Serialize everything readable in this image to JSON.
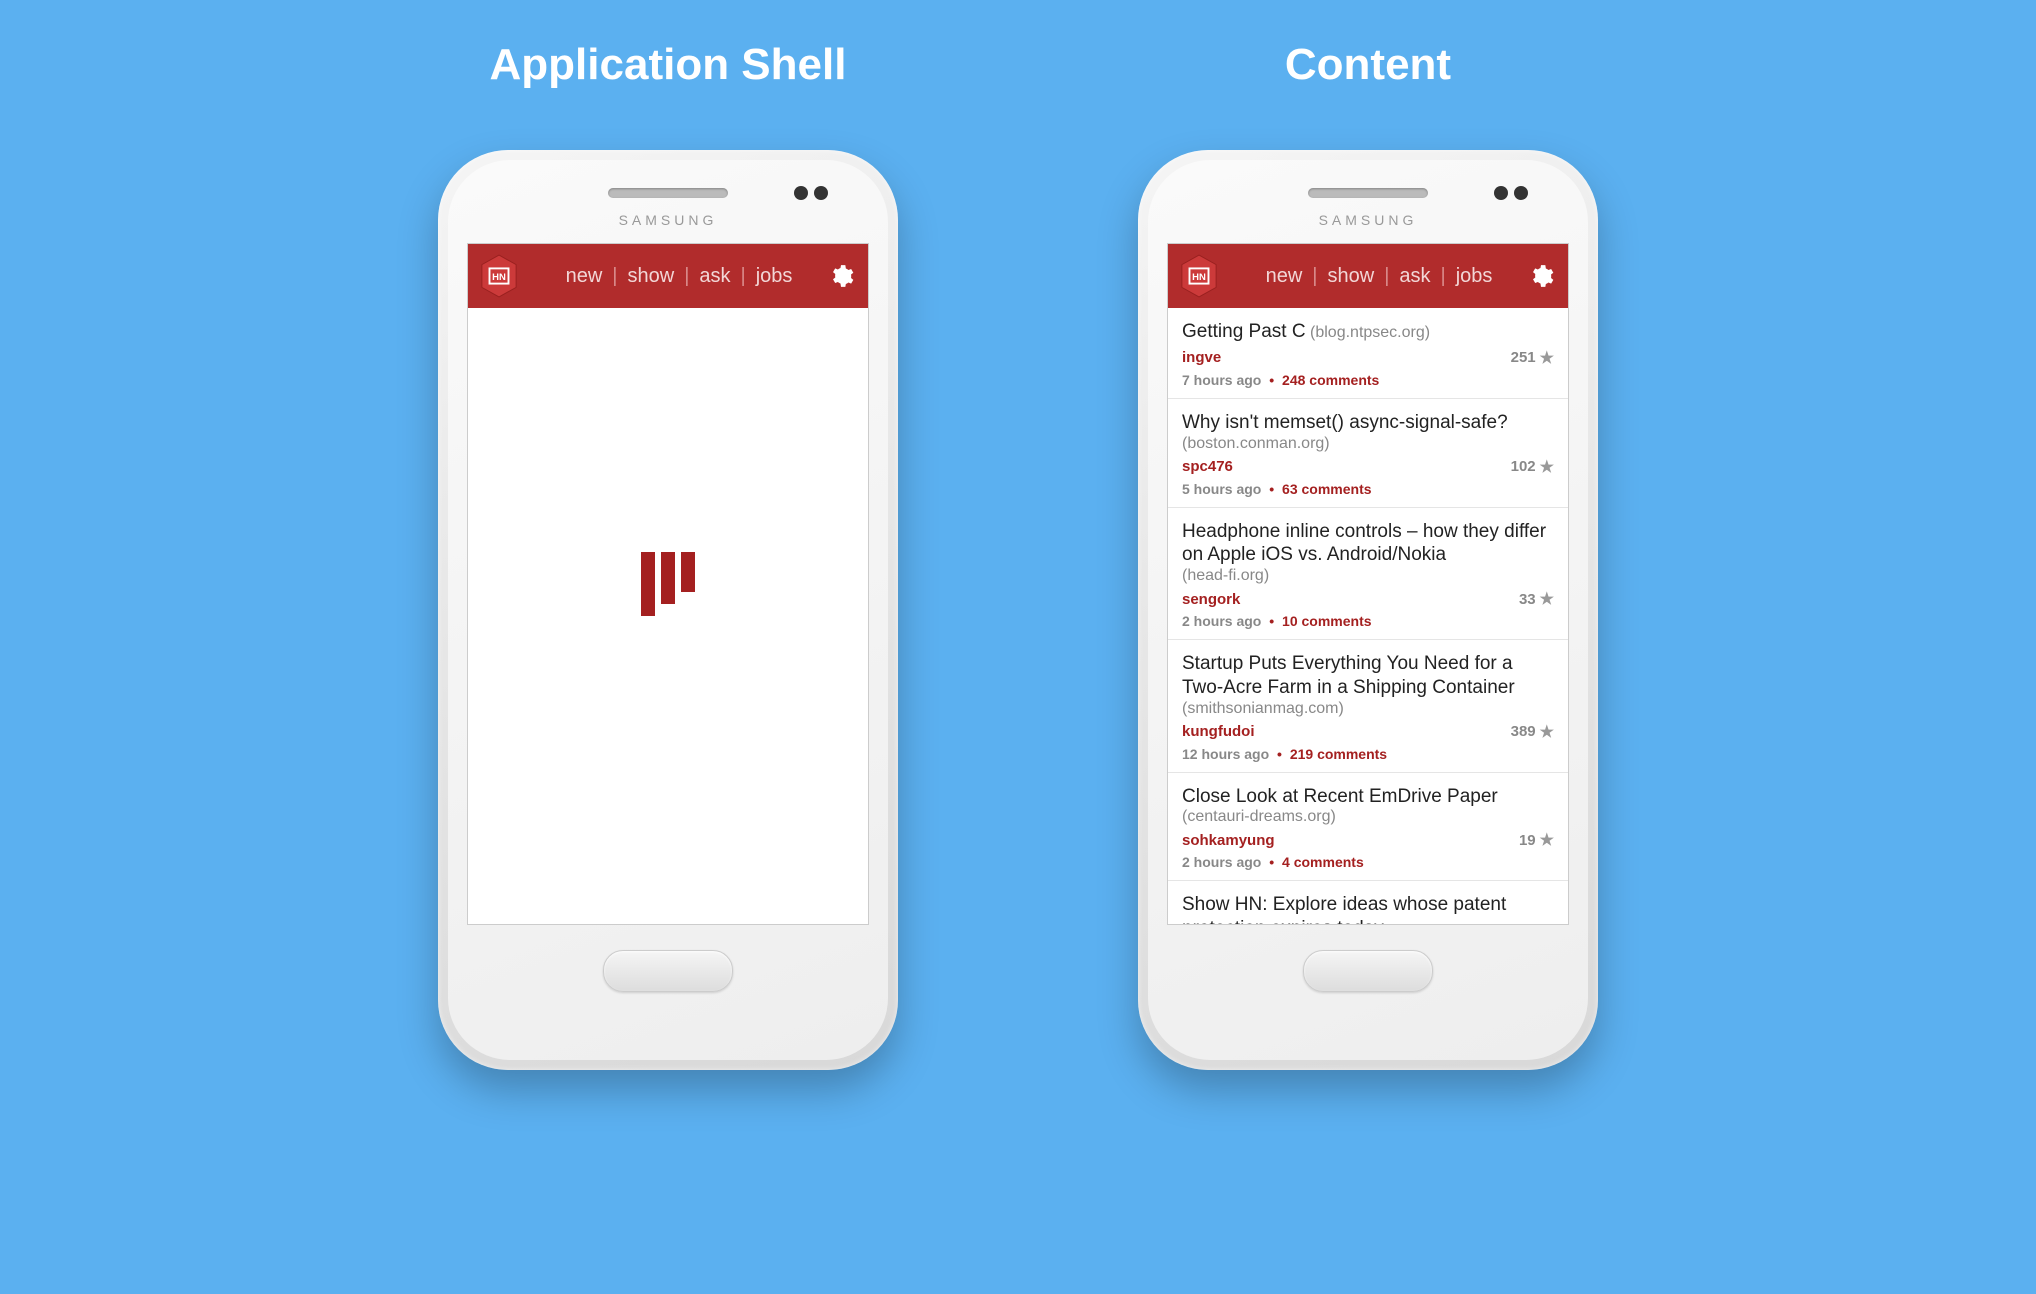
{
  "titles": {
    "left": "Application Shell",
    "right": "Content"
  },
  "phone_brand": "SAMSUNG",
  "app": {
    "logo_text": "HN",
    "nav": [
      "new",
      "show",
      "ask",
      "jobs"
    ]
  },
  "stories": [
    {
      "title": "Getting Past C",
      "domain": "(blog.ntpsec.org)",
      "author": "ingve",
      "points": "251",
      "time": "7 hours ago",
      "comments": "248 comments"
    },
    {
      "title": "Why isn't memset() async-signal-safe?",
      "domain": "(boston.conman.org)",
      "author": "spc476",
      "points": "102",
      "time": "5 hours ago",
      "comments": "63 comments"
    },
    {
      "title": "Headphone inline controls – how they differ on Apple iOS vs. Android/Nokia",
      "domain": "(head-fi.org)",
      "author": "sengork",
      "points": "33",
      "time": "2 hours ago",
      "comments": "10 comments"
    },
    {
      "title": "Startup Puts Everything You Need for a Two-Acre Farm in a Shipping Container",
      "domain": "(smithsonianmag.com)",
      "author": "kungfudoi",
      "points": "389",
      "time": "12 hours ago",
      "comments": "219 comments"
    },
    {
      "title": "Close Look at Recent EmDrive Paper",
      "domain": "(centauri-dreams.org)",
      "author": "sohkamyung",
      "points": "19",
      "time": "2 hours ago",
      "comments": "4 comments"
    },
    {
      "title": "Show HN: Explore ideas whose patent protection expires today",
      "domain": "",
      "author": "",
      "points": "",
      "time": "",
      "comments": ""
    }
  ]
}
